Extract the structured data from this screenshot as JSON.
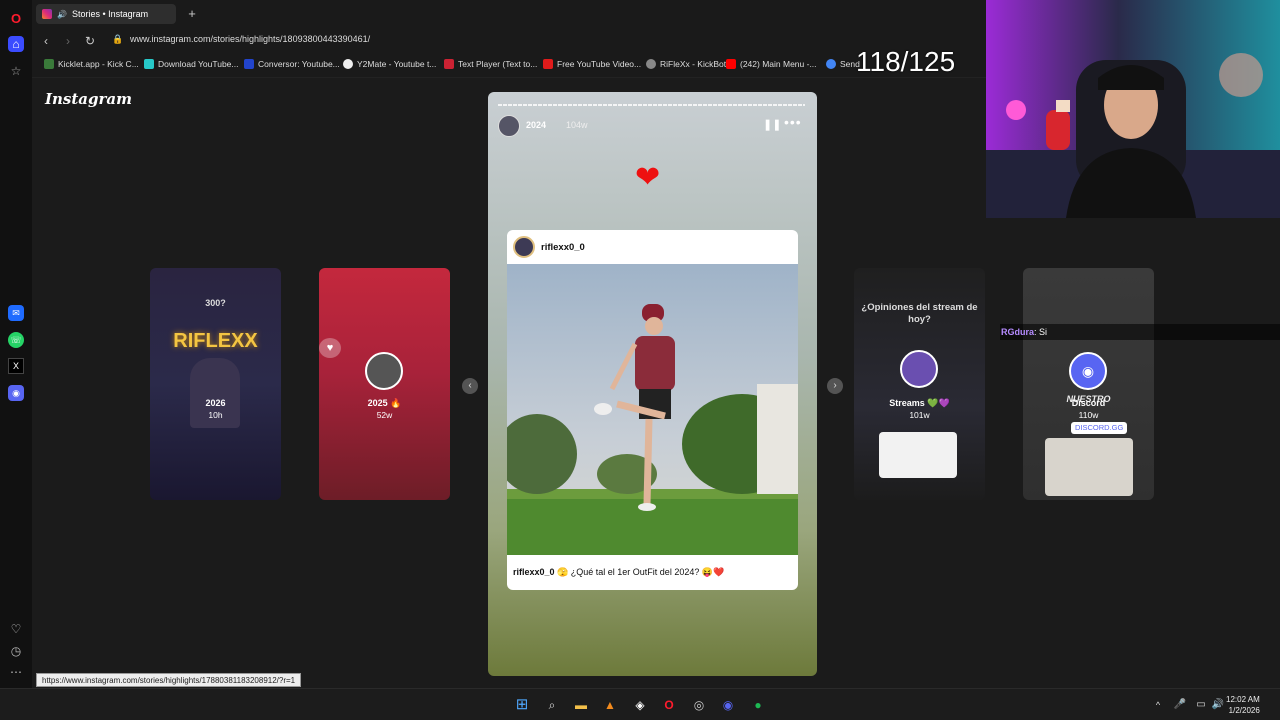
{
  "browser": {
    "tab_title": "Stories • Instagram",
    "new_tab": "+",
    "url": "www.instagram.com/stories/highlights/18093800443390461/",
    "bookmarks": [
      "Kicklet.app - Kick C...",
      "Download YouTube...",
      "Conversor: Youtube...",
      "Y2Mate - Youtube t...",
      "Text Player (Text to...",
      "Free YouTube Video...",
      "RiFleXx - KickBot",
      "(242) Main Menu -...",
      "Send"
    ],
    "status_url": "https://www.instagram.com/stories/highlights/17880381183208912/?r=1"
  },
  "instagram": {
    "logo": "Instagram",
    "main_story": {
      "title": "2024",
      "time": "104w",
      "post_user": "riflexx0_0",
      "caption_user": "riflexx0_0",
      "caption_text": "🫣 ¿Qué tal el 1er OutFit del 2024? 😝❤️"
    },
    "cards": [
      {
        "label": "2026",
        "sub": "10h",
        "top_text": "300?",
        "art_text": "RIFLEXX"
      },
      {
        "label": "2025 🔥",
        "sub": "52w"
      },
      {
        "label": "Streams 💚💜",
        "sub": "101w",
        "top_text": "¿Opiniones del stream de hoy?"
      },
      {
        "label": "Discord",
        "sub": "110w",
        "top_text": "NUESTRO",
        "art_text": "DISCORD.GG"
      }
    ]
  },
  "stream": {
    "counter": "118/125",
    "chat_user": "RGdura",
    "chat_msg": ": Si"
  },
  "clock": {
    "time": "12:02 AM",
    "date": "1/2/2026"
  },
  "colors": {
    "accent_red": "#e11d2a",
    "chat_user": "#b58bff"
  }
}
